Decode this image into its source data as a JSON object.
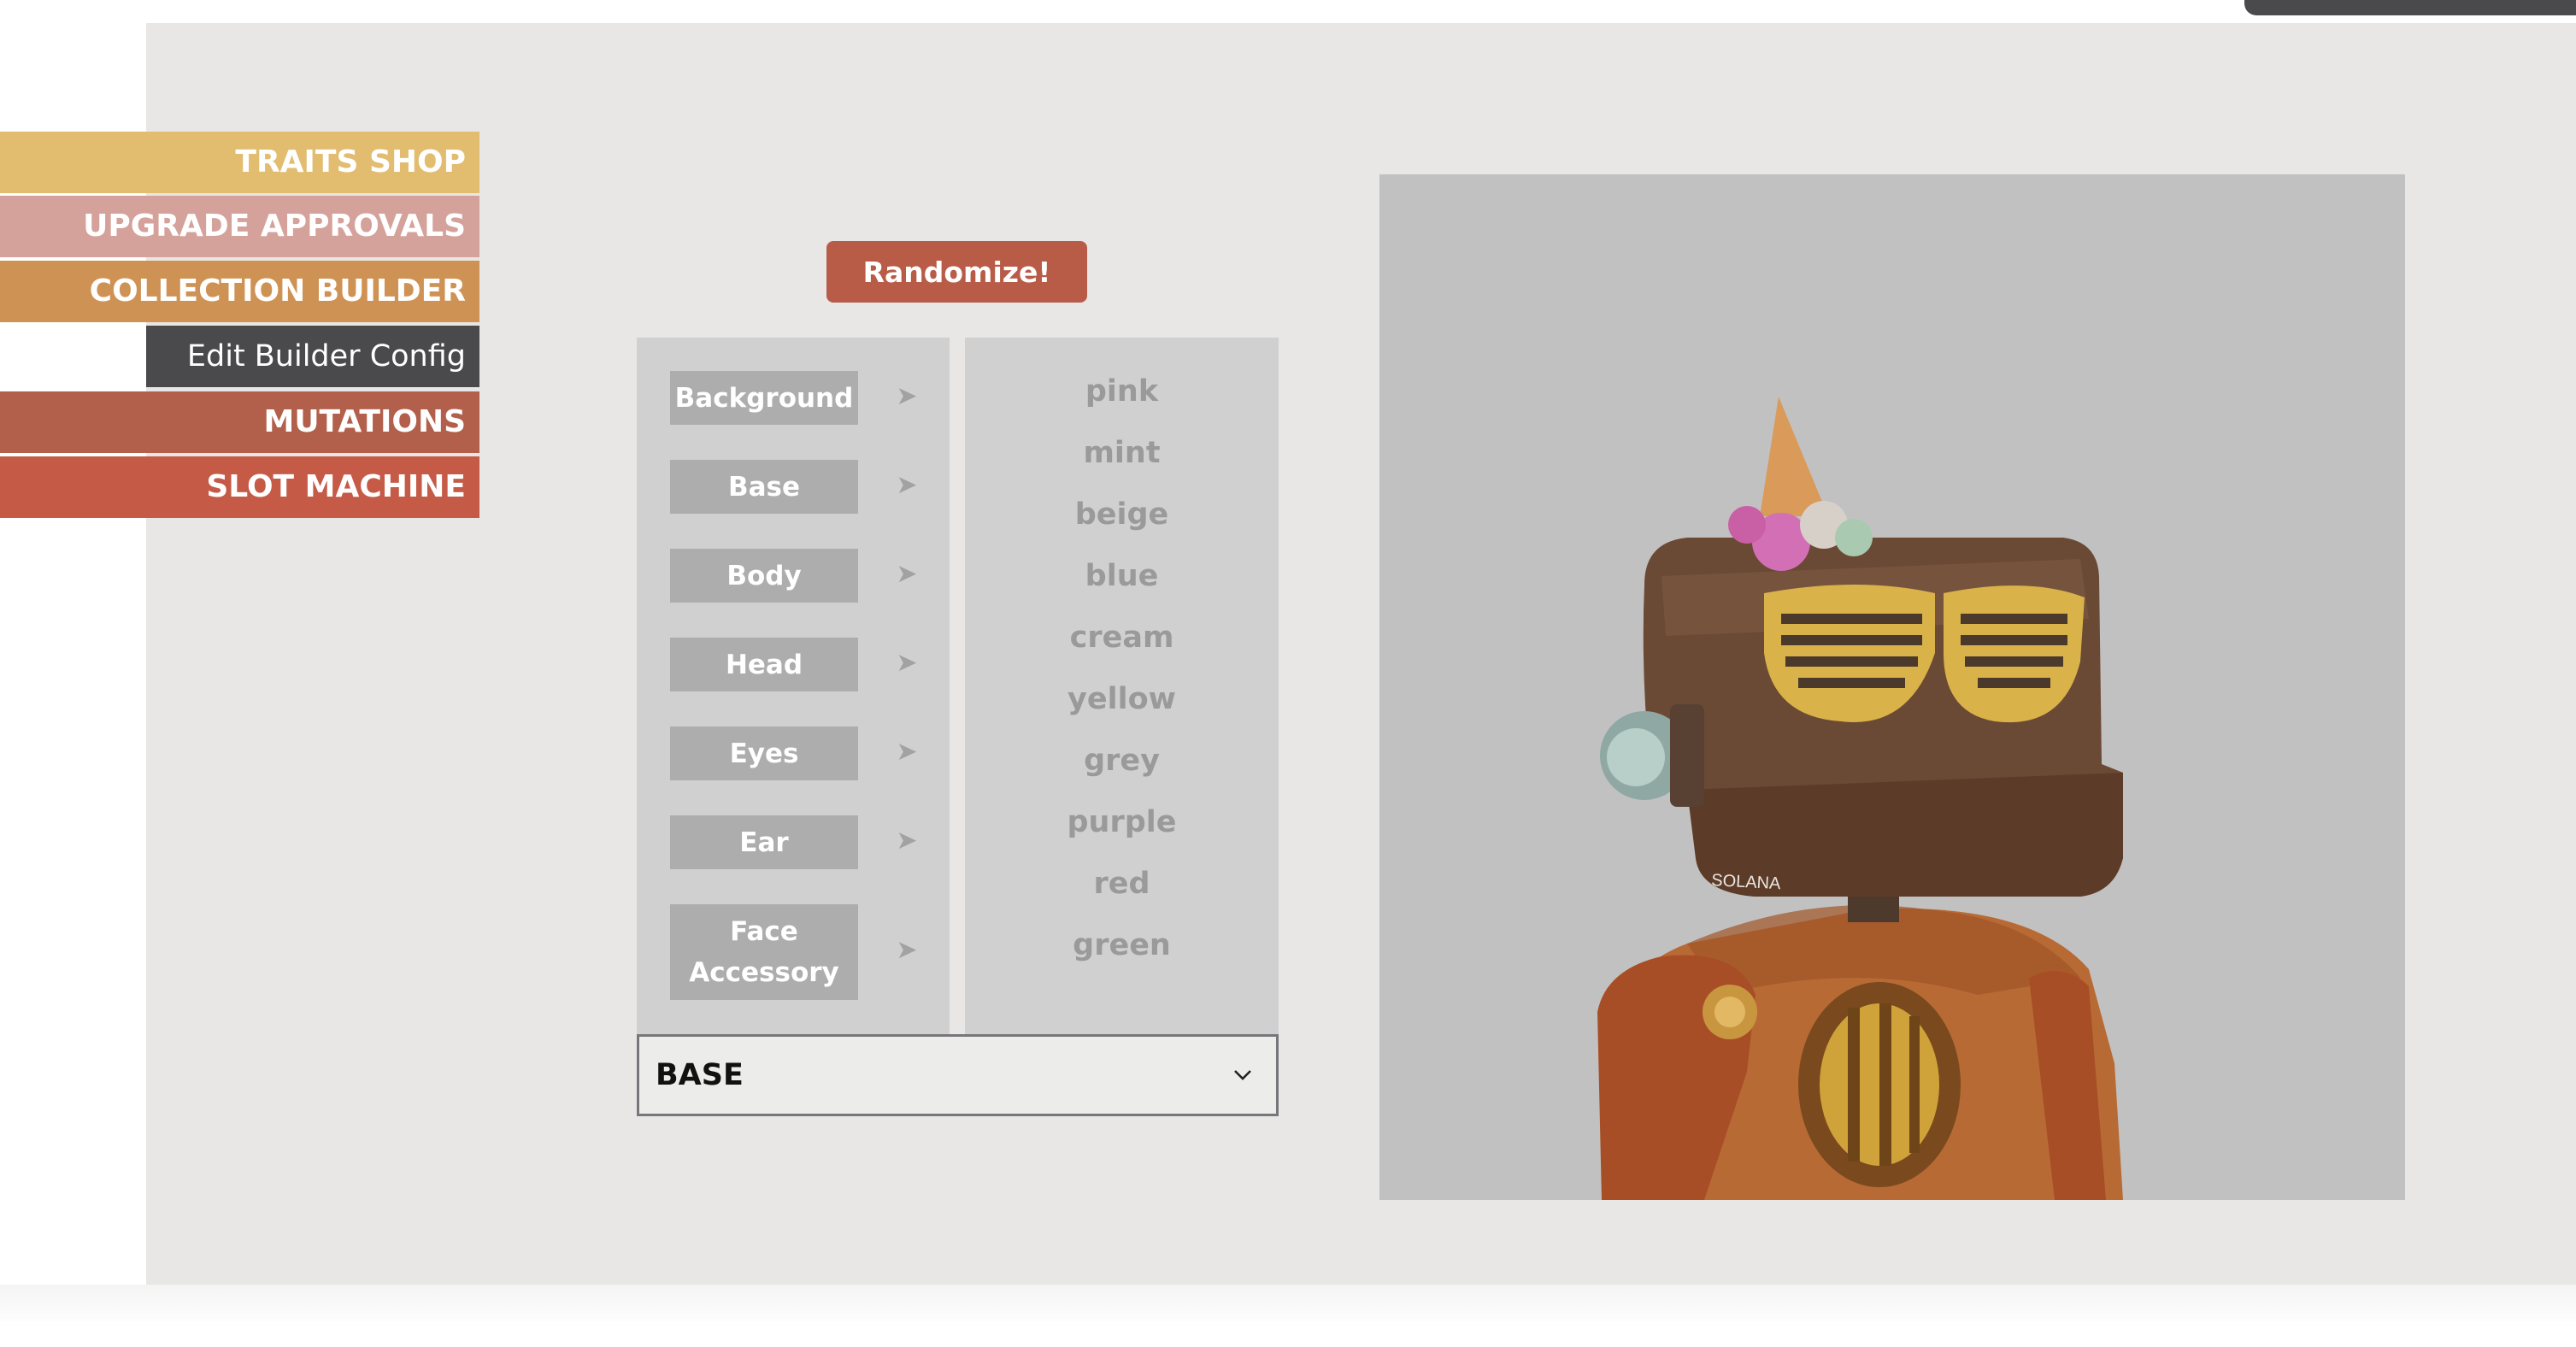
{
  "nav": {
    "items": [
      {
        "label": "TRAITS SHOP",
        "color": "#e2bc6f"
      },
      {
        "label": "UPGRADE APPROVALS",
        "color": "#d4a29a"
      },
      {
        "label": "COLLECTION BUILDER",
        "color": "#cf9255"
      },
      {
        "label": "Edit Builder Config",
        "color": "#4a4a4d"
      },
      {
        "label": "MUTATIONS",
        "color": "#b2604b"
      },
      {
        "label": "SLOT MACHINE",
        "color": "#c55a47"
      }
    ]
  },
  "builder": {
    "randomize_label": "Randomize!",
    "randomize_color": "#b85c48",
    "categories": [
      "Background",
      "Base",
      "Body",
      "Head",
      "Eyes",
      "Ear",
      "Face Accessory"
    ],
    "arrow_icon": "arrow-right-icon",
    "values": [
      "pink",
      "mint",
      "beige",
      "blue",
      "cream",
      "yellow",
      "grey",
      "purple",
      "red",
      "green"
    ],
    "select_value": "BASE",
    "select_icon": "chevron-down-icon"
  },
  "preview": {
    "signature_text": "SOLANA",
    "background_color": "#c2c1c1"
  }
}
